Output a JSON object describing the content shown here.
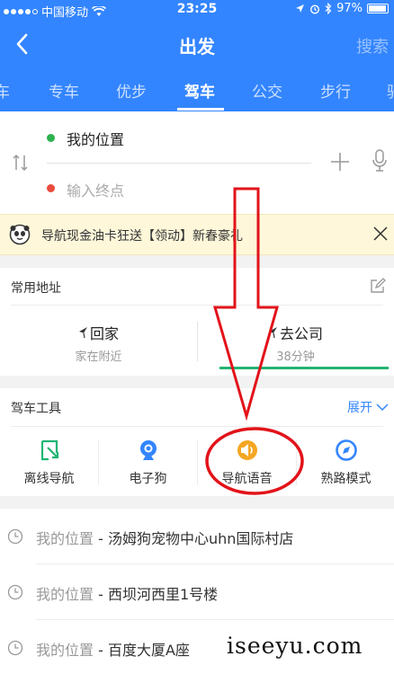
{
  "status_bar": {
    "carrier": "中国移动",
    "time": "23:25",
    "battery": "97%"
  },
  "header": {
    "title": "出发",
    "search_label": "搜索"
  },
  "tabs": [
    {
      "label": "车"
    },
    {
      "label": "专车"
    },
    {
      "label": "优步"
    },
    {
      "label": "驾车",
      "active": true
    },
    {
      "label": "公交"
    },
    {
      "label": "步行"
    },
    {
      "label": "骑"
    }
  ],
  "route": {
    "from": "我的位置",
    "to_placeholder": "输入终点"
  },
  "banner": {
    "text": "导航现金油卡狂送【领动】新春豪礼"
  },
  "frequent": {
    "title": "常用地址",
    "home": {
      "label": "回家",
      "sub": "家在附近"
    },
    "work": {
      "label": "去公司",
      "sub": "38分钟"
    }
  },
  "tools": {
    "title": "驾车工具",
    "expand": "展开",
    "items": [
      {
        "label": "离线导航",
        "icon": "offline-nav-icon",
        "color": "#22b573"
      },
      {
        "label": "电子狗",
        "icon": "camera-dog-icon",
        "color": "#3385ff"
      },
      {
        "label": "导航语音",
        "icon": "speaker-icon",
        "color": "#f5a623"
      },
      {
        "label": "熟路模式",
        "icon": "compass-icon",
        "color": "#3385ff"
      }
    ]
  },
  "history": [
    {
      "from": "我的位置",
      "sep": " - ",
      "to": "汤姆狗宠物中心uhn国际村店"
    },
    {
      "from": "我的位置",
      "sep": " - ",
      "to": "西坝河西里1号楼"
    },
    {
      "from": "我的位置",
      "sep": " - ",
      "to": "百度大厦A座"
    }
  ],
  "watermark": "iseeyu.com",
  "colors": {
    "brand_blue": "#3385ff",
    "annotation_red": "#e2131a"
  }
}
